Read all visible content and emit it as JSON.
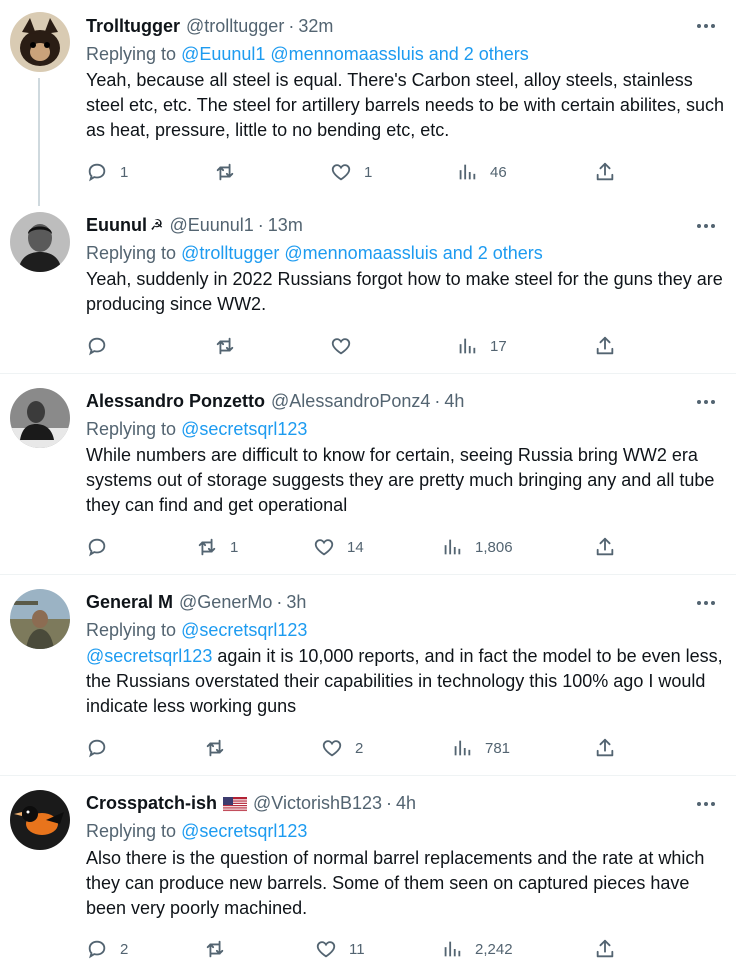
{
  "tweets": [
    {
      "name": "Trolltugger",
      "handle": "@trolltugger",
      "time": "32m",
      "replying_label": "Replying to ",
      "replying_to": "@Euunul1 @mennomaassluis and 2 others",
      "body": "Yeah, because all steel is equal. There's Carbon steel, alloy steels, stainless steel etc, etc. The steel for artillery barrels needs to be with certain abilites, such as heat, pressure, little to no bending etc, etc.",
      "replies": "1",
      "retweets": "",
      "likes": "1",
      "views": "46"
    },
    {
      "name": "Euunul",
      "badge": "☭",
      "handle": "@Euunul1",
      "time": "13m",
      "replying_label": "Replying to ",
      "replying_to": "@trolltugger @mennomaassluis and 2 others",
      "body": "Yeah, suddenly in 2022 Russians forgot how to make steel for the guns they are producing since WW2.",
      "replies": "",
      "retweets": "",
      "likes": "",
      "views": "17"
    },
    {
      "name": "Alessandro Ponzetto",
      "handle": "@AlessandroPonz4",
      "time": "4h",
      "replying_label": "Replying to ",
      "replying_to": "@secretsqrl123",
      "body": "While numbers are difficult to know for certain, seeing Russia bring WW2 era systems out of storage suggests they are pretty much bringing any and all tube they can find and get operational",
      "replies": "",
      "retweets": "1",
      "likes": "14",
      "views": "1,806"
    },
    {
      "name": "General M",
      "handle": "@GenerMo",
      "time": "3h",
      "replying_label": "Replying to ",
      "replying_to": "@secretsqrl123",
      "body_mention": "@secretsqrl123",
      "body": " again it is 10,000 reports, and in fact the model to be even less, the Russians overstated their capabilities in technology this 100% ago I would indicate less working guns",
      "replies": "",
      "retweets": "",
      "likes": "2",
      "views": "781"
    },
    {
      "name": "Crosspatch-ish",
      "flag": "us-flag",
      "handle": "@VictorishB123",
      "time": "4h",
      "replying_label": "Replying to ",
      "replying_to": "@secretsqrl123",
      "body": "Also there is the question of normal barrel replacements and the rate at which they can produce new barrels.  Some of them seen on captured pieces have been very poorly machined.",
      "replies": "2",
      "retweets": "",
      "likes": "11",
      "views": "2,242"
    }
  ],
  "separator": "·",
  "colors": {
    "link": "#1d9bf0",
    "muted": "#536471",
    "text": "#0f1419",
    "divider": "#eff3f4"
  }
}
